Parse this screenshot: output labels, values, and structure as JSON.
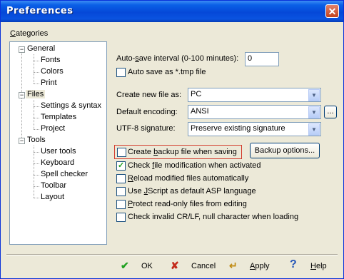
{
  "window": {
    "title": "Preferences"
  },
  "categories": {
    "label_pre": "",
    "label_ul": "C",
    "label_post": "ategories",
    "tree": [
      {
        "label": "General",
        "children": [
          "Fonts",
          "Colors",
          "Print"
        ]
      },
      {
        "label": "Files",
        "children": [
          "Settings & syntax",
          "Templates",
          "Project"
        ]
      },
      {
        "label": "Tools",
        "children": [
          "User tools",
          "Keyboard",
          "Spell checker",
          "Toolbar",
          "Layout"
        ]
      }
    ],
    "selected": "Files"
  },
  "autosave": {
    "label_pre": "Auto-",
    "label_ul": "s",
    "label_post": "ave interval (0-100 minutes):",
    "value": "0",
    "tmp_label": "Auto save as *.tmp file",
    "tmp_checked": false
  },
  "create_new": {
    "label": "Create new file as:",
    "value": "PC"
  },
  "default_encoding": {
    "label": "Default encoding:",
    "value": "ANSI",
    "button": "..."
  },
  "utf8": {
    "label": "UTF-8 signature:",
    "value": "Preserve existing signature"
  },
  "backup": {
    "label_pre": "Create ",
    "label_ul": "b",
    "label_post": "ackup file when saving",
    "checked": false,
    "options_button": "Backup options..."
  },
  "options": [
    {
      "pre": "Check ",
      "ul": "f",
      "post": "ile modification when activated",
      "checked": true
    },
    {
      "pre": "",
      "ul": "R",
      "post": "eload modified files automatically",
      "checked": false
    },
    {
      "pre": "Use ",
      "ul": "J",
      "post": "Script as default ASP language",
      "checked": false
    },
    {
      "pre": "",
      "ul": "P",
      "post": "rotect read-only files from editing",
      "checked": false
    },
    {
      "pre": "Check invalid CR/LF, null character when loading",
      "ul": "",
      "post": "",
      "checked": false
    }
  ],
  "footer": {
    "ok": "OK",
    "cancel": "Cancel",
    "apply_ul": "A",
    "apply_post": "pply",
    "help_ul": "H",
    "help_post": "elp"
  },
  "colors": {
    "titlebar": "#0a5fe6",
    "dialog_bg": "#ece9d8",
    "highlight_border": "#d23a2c",
    "ok_check": "#21a121",
    "cancel_x": "#c42b1c"
  },
  "icons": {
    "close": "close-icon",
    "ok": "check-icon",
    "cancel": "x-icon",
    "apply": "apply-arrow-icon",
    "help": "question-icon"
  }
}
